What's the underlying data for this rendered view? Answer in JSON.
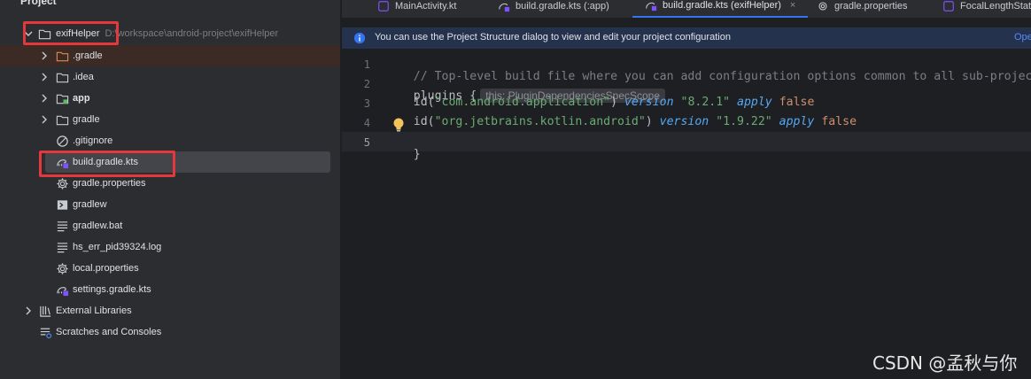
{
  "project_panel": {
    "title": "Project",
    "root": {
      "name": "exifHelper",
      "path": "D:\\workspace\\android-project\\exifHelper"
    },
    "items": [
      {
        "label": ".gradle",
        "icon": "folder-orange-icon"
      },
      {
        "label": ".idea",
        "icon": "folder-icon"
      },
      {
        "label": "app",
        "icon": "module-folder-icon"
      },
      {
        "label": "gradle",
        "icon": "folder-icon"
      },
      {
        "label": ".gitignore",
        "icon": "ignore-file-icon"
      },
      {
        "label": "build.gradle.kts",
        "icon": "gradle-kts-icon"
      },
      {
        "label": "gradle.properties",
        "icon": "settings-gear-icon"
      },
      {
        "label": "gradlew",
        "icon": "terminal-file-icon"
      },
      {
        "label": "gradlew.bat",
        "icon": "text-file-icon"
      },
      {
        "label": "hs_err_pid39324.log",
        "icon": "text-file-icon"
      },
      {
        "label": "local.properties",
        "icon": "settings-gear-icon"
      },
      {
        "label": "settings.gradle.kts",
        "icon": "gradle-kts-icon"
      }
    ],
    "external_libraries": "External Libraries",
    "scratches": "Scratches and Consoles"
  },
  "tabs": [
    {
      "label": "MainActivity.kt"
    },
    {
      "label": "build.gradle.kts (:app)"
    },
    {
      "label": "build.gradle.kts (exifHelper)",
      "active": true,
      "close": "×"
    },
    {
      "label": "gradle.properties"
    },
    {
      "label": "FocalLengthStat"
    }
  ],
  "banner": {
    "text": "You can use the Project Structure dialog to view and edit your project configuration",
    "link": "Ope"
  },
  "editor": {
    "line_numbers": [
      "1",
      "2",
      "3",
      "4",
      "5"
    ],
    "line1_comment": "// Top-level build file where you can add configuration options common to all sub-projects/",
    "line2_plugins": "plugins",
    "line2_brace": " {",
    "inlay_hint": "this: PluginDependenciesSpecScope",
    "line3": {
      "id": "    id(",
      "arg": "\"com.android.application\"",
      "close": ") ",
      "version_kw": "version",
      "version": "\"8.2.1\"",
      "apply_kw": "apply",
      "false_kw": "false"
    },
    "line4": {
      "id": "    id(",
      "arg": "\"org.jetbrains.kotlin.android\"",
      "close": ") ",
      "version_kw": "version",
      "version": "\"1.9.22\"",
      "apply_kw": "apply",
      "false_kw": "false"
    },
    "line5": "}"
  },
  "watermark": "CSDN @孟秋与你",
  "colors": {
    "accent": "#3574f0",
    "highlight_box": "#e5383b",
    "banner_bg": "#25324d"
  }
}
